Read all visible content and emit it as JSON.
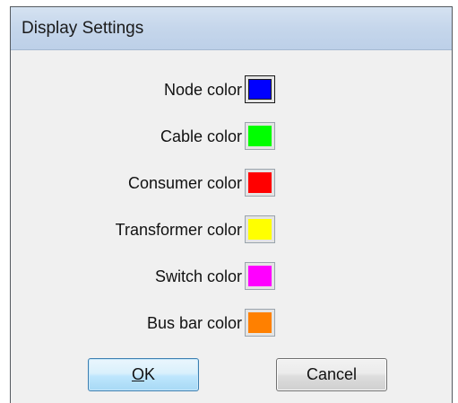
{
  "window": {
    "title": "Display Settings"
  },
  "colors": [
    {
      "label": "Node color",
      "swatch": "#0000ff",
      "selected": true
    },
    {
      "label": "Cable color",
      "swatch": "#00ff00",
      "selected": false
    },
    {
      "label": "Consumer color",
      "swatch": "#ff0000",
      "selected": false
    },
    {
      "label": "Transformer color",
      "swatch": "#ffff00",
      "selected": false
    },
    {
      "label": "Switch color",
      "swatch": "#ff00ff",
      "selected": false
    },
    {
      "label": "Bus bar color",
      "swatch": "#ff8000",
      "selected": false
    }
  ],
  "buttons": {
    "ok": {
      "mnemonic": "O",
      "rest": "K"
    },
    "cancel": "Cancel"
  }
}
